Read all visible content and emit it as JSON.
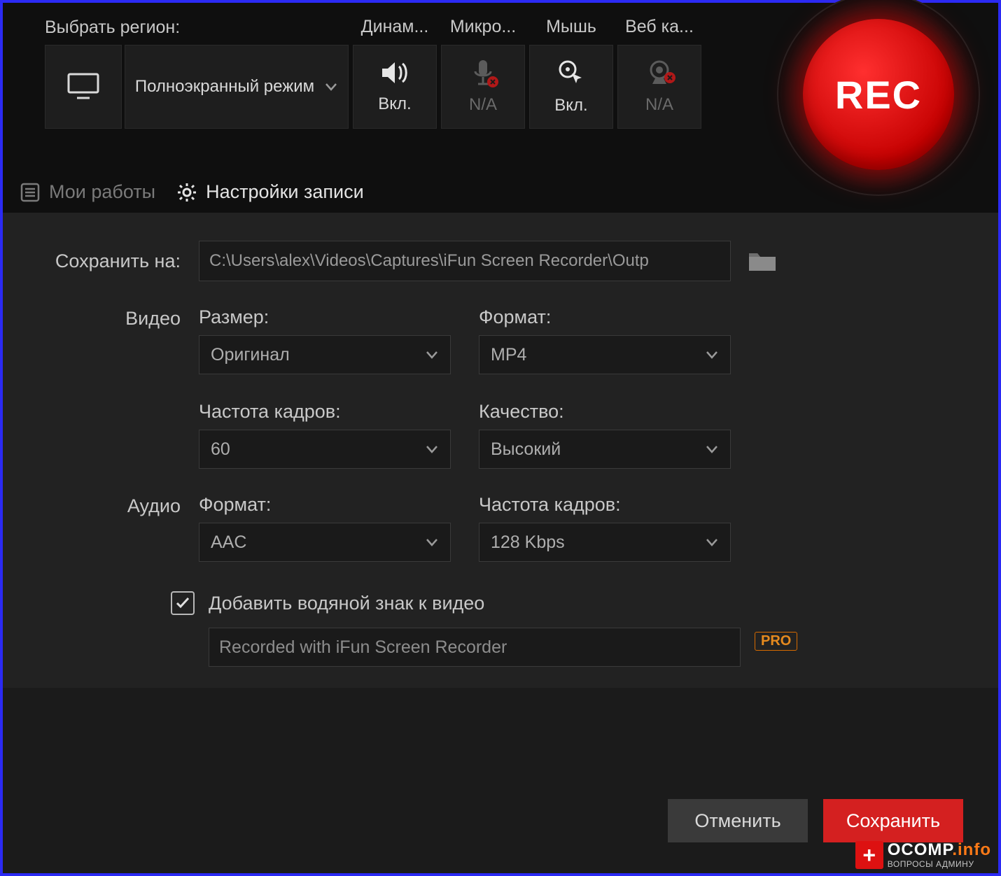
{
  "toolbar": {
    "region_label": "Выбрать регион:",
    "mode": "Полноэкранный режим",
    "columns": {
      "speaker": {
        "header": "Динам...",
        "state": "Вкл."
      },
      "mic": {
        "header": "Микро...",
        "state": "N/A"
      },
      "mouse": {
        "header": "Мышь",
        "state": "Вкл."
      },
      "webcam": {
        "header": "Веб ка...",
        "state": "N/A"
      }
    },
    "rec_label": "REC"
  },
  "tabs": {
    "works": "Мои работы",
    "settings": "Настройки записи"
  },
  "settings": {
    "save_to_label": "Сохранить на:",
    "save_to_path": "C:\\Users\\alex\\Videos\\Captures\\iFun Screen Recorder\\Outp",
    "video_label": "Видео",
    "audio_label": "Аудио",
    "video": {
      "size_label": "Размер:",
      "size_value": "Оригинал",
      "format_label": "Формат:",
      "format_value": "MP4",
      "fps_label": "Частота кадров:",
      "fps_value": "60",
      "quality_label": "Качество:",
      "quality_value": "Высокий"
    },
    "audio": {
      "format_label": "Формат:",
      "format_value": "AAC",
      "bitrate_label": "Частота кадров:",
      "bitrate_value": "128 Kbps"
    },
    "watermark": {
      "checkbox_label": "Добавить водяной знак к видео",
      "text": "Recorded with iFun Screen Recorder",
      "pro": "PRO"
    }
  },
  "buttons": {
    "cancel": "Отменить",
    "save": "Сохранить"
  },
  "branding": {
    "plus": "+",
    "name_main": "OCOMP",
    "name_suffix": ".info",
    "tagline": "ВОПРОСЫ АДМИНУ"
  }
}
